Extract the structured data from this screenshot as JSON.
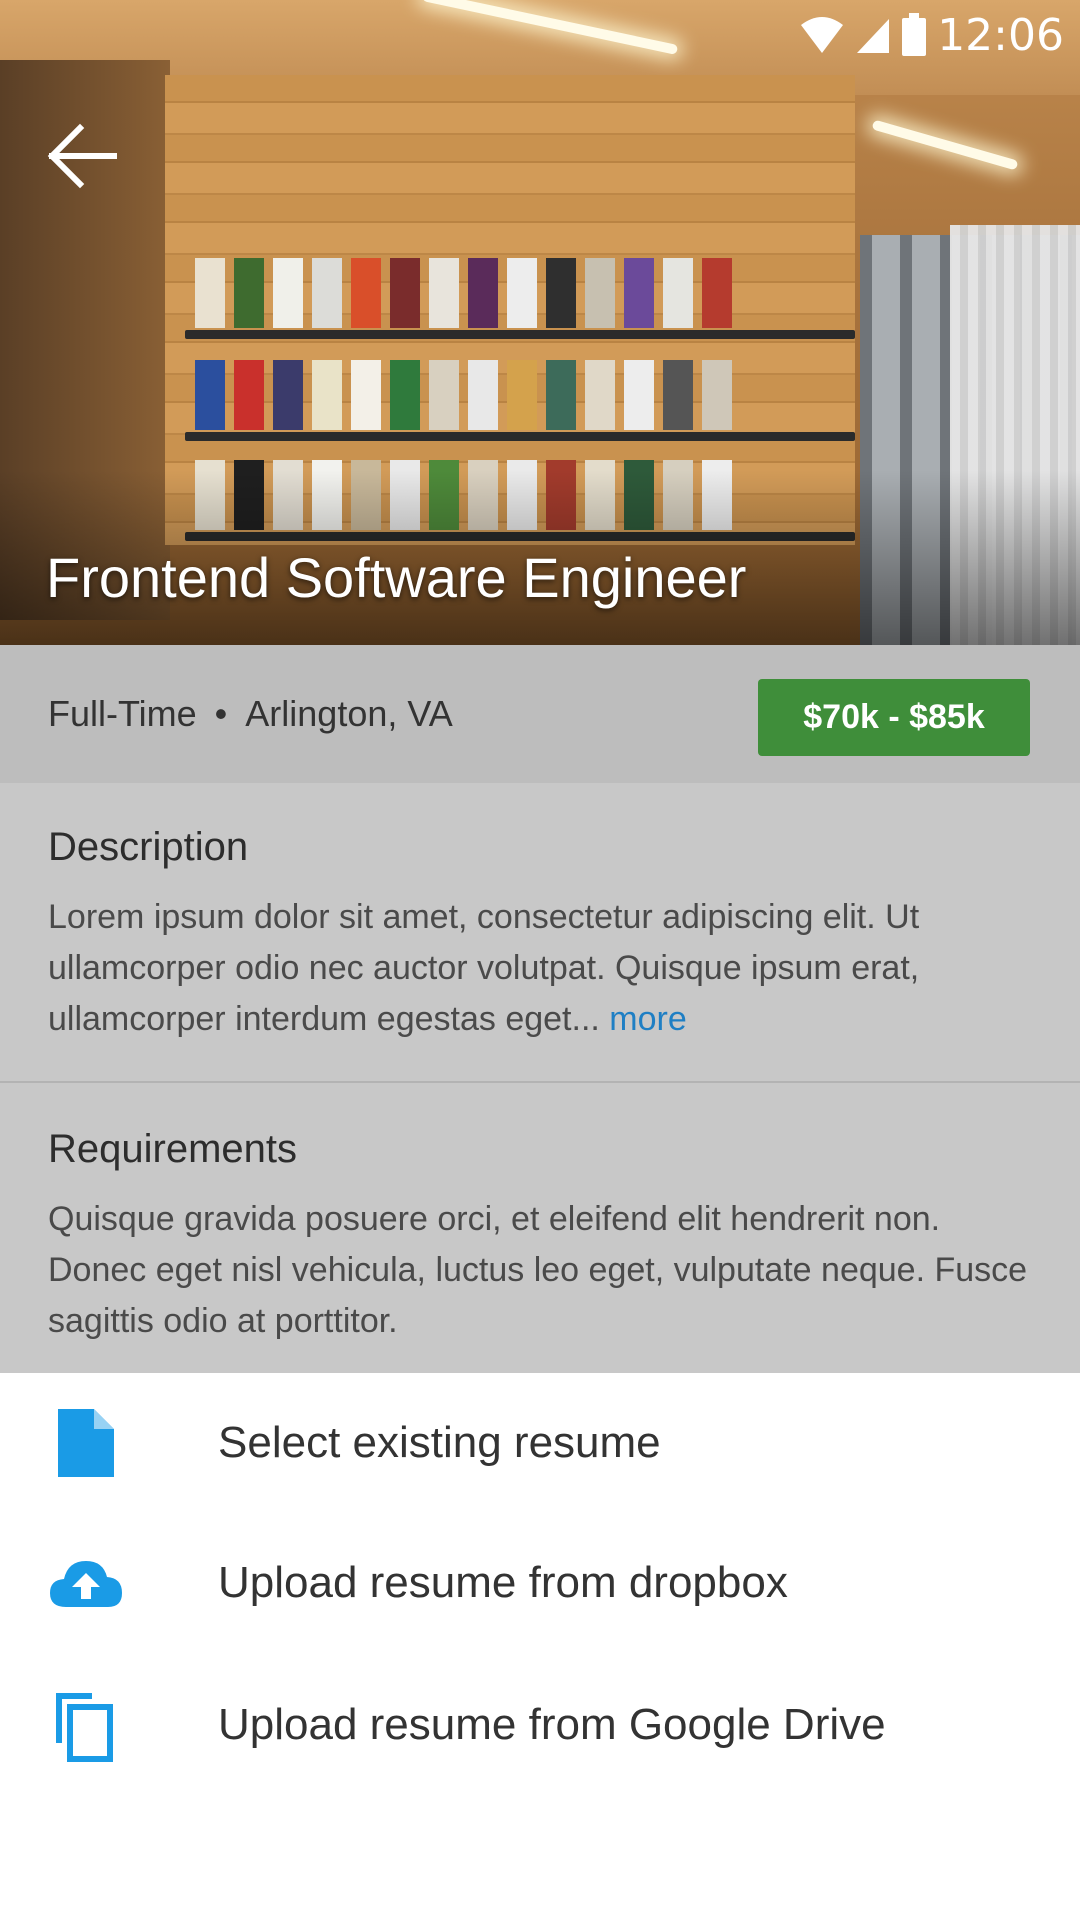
{
  "status_bar": {
    "time": "12:06",
    "icons": [
      "wifi-icon",
      "signal-icon",
      "battery-icon"
    ]
  },
  "header": {
    "back_icon": "arrow-back-icon",
    "title": "Frontend Software Engineer"
  },
  "job": {
    "type": "Full-Time",
    "separator": "•",
    "location": "Arlington, VA",
    "salary": "$70k - $85k"
  },
  "description": {
    "heading": "Description",
    "text": "Lorem ipsum dolor sit amet, consectetur adipiscing elit. Ut ullamcorper odio nec auctor volutpat. Quisque ipsum erat, ullamcorper interdum egestas eget...",
    "more_label": "more"
  },
  "requirements": {
    "heading": "Requirements",
    "text": "Quisque gravida posuere orci, et eleifend elit hendrerit non. Donec eget nisl vehicula, luctus leo eget, vulputate neque. Fusce sagittis odio at porttitor."
  },
  "sheet": {
    "options": [
      {
        "icon": "file-icon",
        "label": "Select existing resume"
      },
      {
        "icon": "cloud-upload-icon",
        "label": "Upload resume from dropbox"
      },
      {
        "icon": "copy-icon",
        "label": "Upload resume from Google Drive"
      }
    ]
  },
  "colors": {
    "accent": "#1a9be6",
    "salary_badge": "#3f8e3a",
    "link": "#1f7fc4",
    "scrim": "#c8c8c8",
    "sheet": "#ffffff"
  }
}
